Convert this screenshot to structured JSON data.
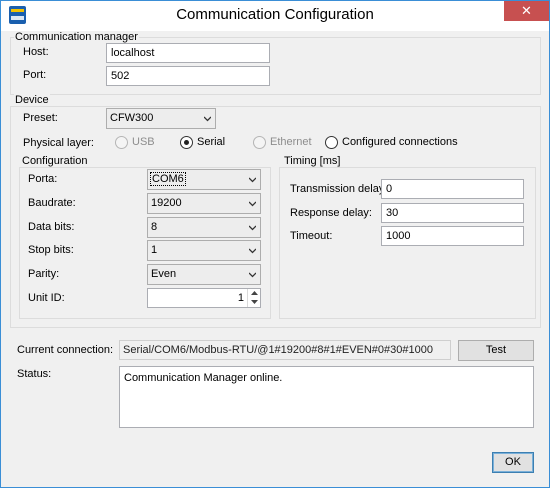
{
  "window": {
    "title": "Communication Configuration",
    "close_glyph": "✕"
  },
  "manager": {
    "group_label": "Communication manager",
    "host_label": "Host:",
    "host_value": "localhost",
    "port_label": "Port:",
    "port_value": "502"
  },
  "device": {
    "group_label": "Device",
    "preset_label": "Preset:",
    "preset_value": "CFW300",
    "physical_layer_label": "Physical layer:",
    "layers": [
      {
        "label": "USB",
        "enabled": false,
        "selected": false
      },
      {
        "label": "Serial",
        "enabled": true,
        "selected": true
      },
      {
        "label": "Ethernet",
        "enabled": false,
        "selected": false
      },
      {
        "label": "Configured connections",
        "enabled": true,
        "selected": false
      }
    ]
  },
  "configuration": {
    "group_label": "Configuration",
    "porta_label": "Porta:",
    "porta_value": "COM6",
    "baudrate_label": "Baudrate:",
    "baudrate_value": "19200",
    "databits_label": "Data bits:",
    "databits_value": "8",
    "stopbits_label": "Stop bits:",
    "stopbits_value": "1",
    "parity_label": "Parity:",
    "parity_value": "Even",
    "unitid_label": "Unit ID:",
    "unitid_value": "1"
  },
  "timing": {
    "group_label": "Timing [ms]",
    "transmission_label": "Transmission delay:",
    "transmission_value": "0",
    "response_label": "Response delay:",
    "response_value": "30",
    "timeout_label": "Timeout:",
    "timeout_value": "1000"
  },
  "connection": {
    "current_label": "Current connection:",
    "current_value": "Serial/COM6/Modbus-RTU/@1#19200#8#1#EVEN#0#30#1000",
    "test_label": "Test",
    "status_label": "Status:",
    "status_value": "Communication Manager online."
  },
  "footer": {
    "ok_label": "OK"
  },
  "icons": {
    "app": "app-logo-icon",
    "close": "close-icon",
    "dropdown": "chevron-down-icon",
    "spin_up": "spin-up-icon",
    "spin_down": "spin-down-icon"
  },
  "colors": {
    "window_border": "#3a8ed6",
    "close_button": "#c75050",
    "default_button_border": "#3c7fb1"
  }
}
